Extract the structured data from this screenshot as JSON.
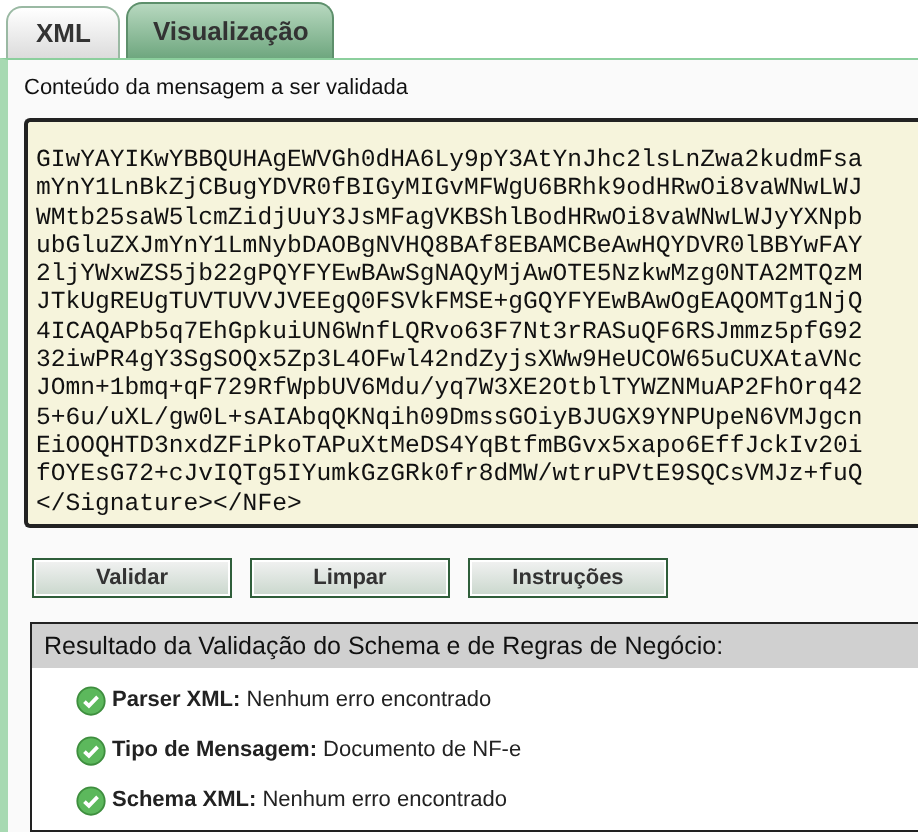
{
  "tabs": [
    {
      "label": "XML",
      "selected": false
    },
    {
      "label": "Visualização",
      "selected": true
    }
  ],
  "message": {
    "label": "Conteúdo da mensagem a ser validada",
    "lines": [
      "GIwYAYIKwYBBQUHAgEWVGh0dHA6Ly9pY3AtYnJhc2lsLnZwa2kudmFsa",
      "mYnY1LnBkZjCBugYDVR0fBIGyMIGvMFWgU6BRhk9odHRwOi8vaWNwLWJ",
      "WMtb25saW5lcmZidjUuY3JsMFagVKBShlBodHRwOi8vaWNwLWJyYXNpb",
      "ubGluZXJmYnY1LmNybDAOBgNVHQ8BAf8EBAMCBeAwHQYDVR0lBBYwFAY",
      "2ljYWxwZS5jb22gPQYFYEwBAwSgNAQyMjAwOTE5NzkwMzg0NTA2MTQzM",
      "JTkUgREUgTUVTUVVJVEEgQ0FSVkFMSE+gGQYFYEwBAwOgEAQOMTg1NjQ",
      "4ICAQAPb5q7EhGpkuiUN6WnfLQRvo63F7Nt3rRASuQF6RSJmmz5pfG92",
      "32iwPR4gY3SgSOQx5Zp3L4OFwl42ndZyjsXWw9HeUCOW65uCUXAtaVNc",
      "JOmn+1bmq+qF729RfWpbUV6Mdu/yq7W3XE2OtblTYWZNMuAP2FhOrq42",
      "5+6u/uXL/gw0L+sAIAbqQKNqih09DmssGOiyBJUGX9YNPUpeN6VMJgcn",
      "EiOOQHTD3nxdZFiPkoTAPuXtMeDS4YqBtfmBGvx5xapo6EffJckIv20i",
      "fOYEsG72+cJvIQTg5IYumkGzGRk0fr8dMW/wtruPVtE9SQCsVMJz+fuQ",
      "</Signature></NFe>"
    ]
  },
  "buttons": [
    "Validar",
    "Limpar",
    "Instruções"
  ],
  "result": {
    "title": "Resultado da Validação do Schema e de Regras de Negócio:",
    "items": [
      {
        "label": "Parser XML:",
        "value": "Nenhum erro encontrado",
        "kind": "ok"
      },
      {
        "label": "Tipo de Mensagem:",
        "value": "Documento de NF-e",
        "kind": "ok"
      },
      {
        "label": "Schema XML:",
        "value": "Nenhum erro encontrado",
        "kind": "ok"
      }
    ]
  }
}
